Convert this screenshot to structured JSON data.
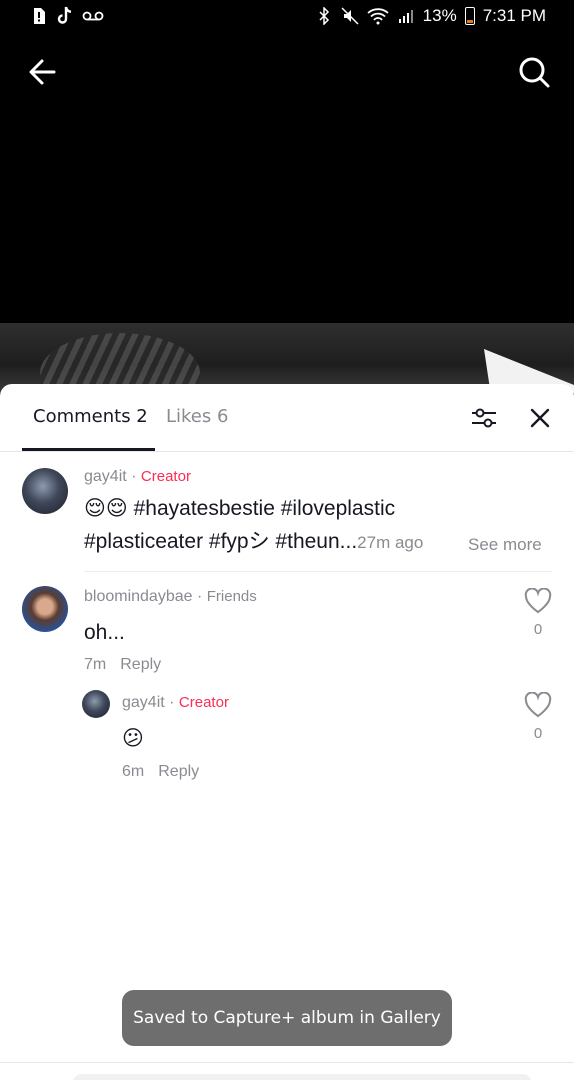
{
  "status_bar": {
    "battery": "13%",
    "time": "7:31 PM",
    "left_icons": [
      "sim-alert-icon",
      "tiktok-icon",
      "voicemail-icon"
    ],
    "right_icons": [
      "bluetooth-icon",
      "mute-icon",
      "wifi-icon",
      "signal-icon",
      "battery-icon"
    ]
  },
  "nav": {
    "back_icon": "arrow-left-icon",
    "search_icon": "search-icon"
  },
  "sheet": {
    "tabs": [
      {
        "label": "Comments 2",
        "active": true
      },
      {
        "label": "Likes 6",
        "active": false
      }
    ],
    "filter_icon": "sliders-icon",
    "close_icon": "close-icon"
  },
  "comments": [
    {
      "username": "gay4it",
      "separator": " · ",
      "tag": "Creator",
      "line1": "😌😌 #hayatesbestie #iloveplastic",
      "line2": "#plasticeater #fypシ #theun...",
      "time": "27m ago",
      "see_more": "See more"
    },
    {
      "username": "bloomindaybae",
      "separator": " · ",
      "tag": "Friends",
      "text": "oh...",
      "time": "7m",
      "reply": "Reply",
      "likes": "0"
    },
    {
      "username": "gay4it",
      "separator": " · ",
      "tag": "Creator",
      "text": "😕",
      "time": "6m",
      "reply": "Reply",
      "likes": "0"
    }
  ],
  "toast": "Saved to Capture+ album in Gallery",
  "colors": {
    "creator_tag": "#fe2c55",
    "muted": "#8a8b91",
    "text": "#161823"
  }
}
